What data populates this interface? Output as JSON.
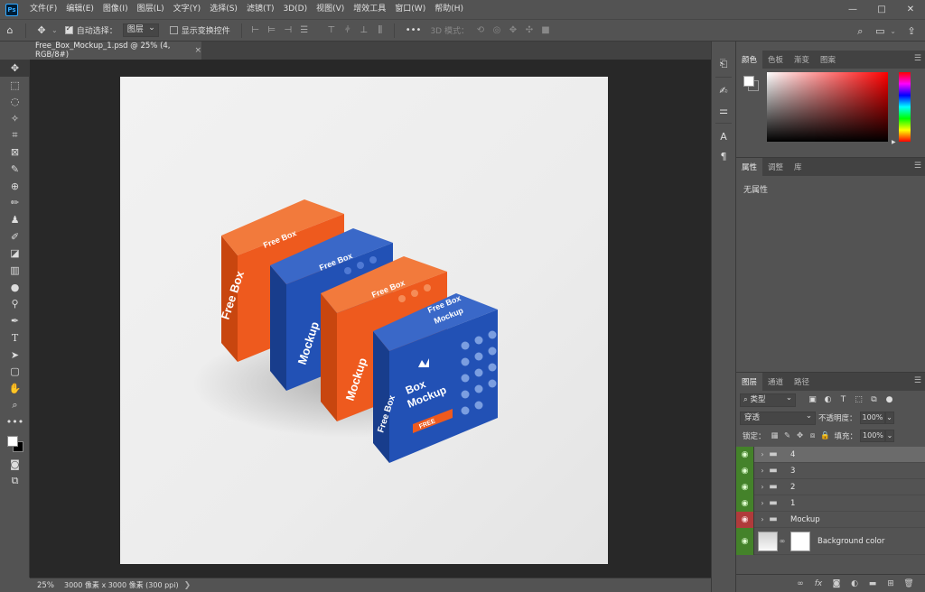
{
  "app": {
    "logo": "Ps"
  },
  "menu": [
    "文件(F)",
    "编辑(E)",
    "图像(I)",
    "图层(L)",
    "文字(Y)",
    "选择(S)",
    "滤镜(T)",
    "3D(D)",
    "视图(V)",
    "增效工具",
    "窗口(W)",
    "帮助(H)"
  ],
  "window_controls": {
    "minimize": "—",
    "maximize": "□",
    "close": "✕"
  },
  "options": {
    "auto_select_label": "自动选择：",
    "auto_select_value": "图层",
    "show_transform_label": "显示变换控件",
    "mode_3d_label": "3D 模式：",
    "more": "•••"
  },
  "document": {
    "tab_title": "Free_Box_Mockup_1.psd @ 25% (4, RGB/8#)",
    "close": "×"
  },
  "status": {
    "zoom": "25%",
    "info": "3000 像素 x 3000 像素 (300 ppi)",
    "arrow": "❯"
  },
  "color_panel": {
    "tabs": [
      "颜色",
      "色板",
      "渐变",
      "图案"
    ],
    "active_tab": 0
  },
  "properties_panel": {
    "tabs": [
      "属性",
      "调整",
      "库"
    ],
    "active_tab": 0,
    "empty_text": "无属性"
  },
  "layers_panel": {
    "tabs": [
      "图层",
      "通道",
      "路径"
    ],
    "active_tab": 0,
    "kind_filter": "类型",
    "blend_mode": "穿透",
    "opacity_label": "不透明度：",
    "opacity": "100%",
    "lock_label": "锁定：",
    "fill_label": "填充：",
    "fill": "100%",
    "layers": [
      {
        "name": "4",
        "type": "group",
        "selected": true,
        "eye": "green"
      },
      {
        "name": "3",
        "type": "group",
        "selected": false,
        "eye": "green"
      },
      {
        "name": "2",
        "type": "group",
        "selected": false,
        "eye": "green"
      },
      {
        "name": "1",
        "type": "group",
        "selected": false,
        "eye": "green"
      },
      {
        "name": "Mockup",
        "type": "group",
        "selected": false,
        "eye": "red"
      },
      {
        "name": "Background color",
        "type": "fill",
        "selected": false,
        "eye": "green"
      }
    ]
  },
  "mockup": {
    "brand_title": "Free Box",
    "brand_title2": "Mockup",
    "big_title": "Box",
    "big_title2": "Mockup",
    "badge": "FREE",
    "side_text": "Free Box",
    "colors": {
      "orange": "#ee5a1e",
      "blue": "#2251b5"
    }
  }
}
